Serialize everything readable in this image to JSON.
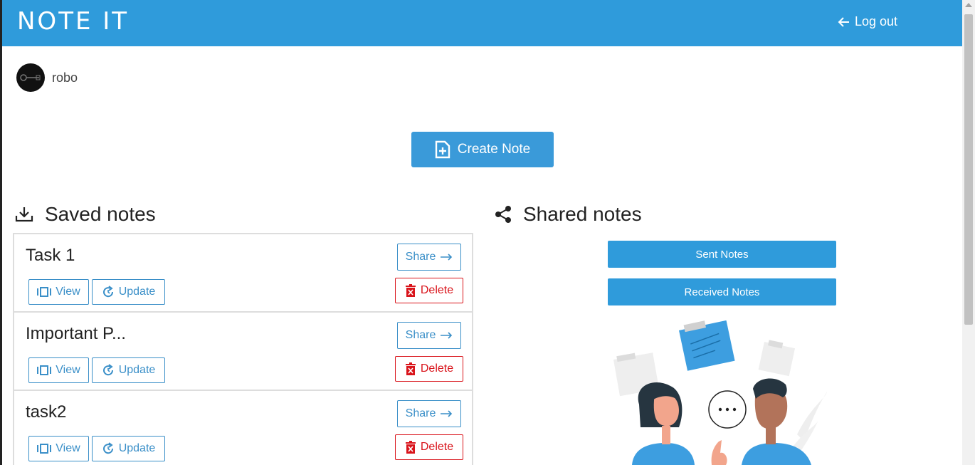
{
  "navbar": {
    "brand": "NOTE IT",
    "logout_label": "Log out"
  },
  "user": {
    "name": "robo"
  },
  "actions": {
    "create_note_label": "Create Note"
  },
  "saved": {
    "title": "Saved notes",
    "notes": [
      {
        "title": "Task 1",
        "share": "Share",
        "view": "View",
        "update": "Update",
        "delete": "Delete"
      },
      {
        "title": "Important P...",
        "share": "Share",
        "view": "View",
        "update": "Update",
        "delete": "Delete"
      },
      {
        "title": "task2",
        "share": "Share",
        "view": "View",
        "update": "Update",
        "delete": "Delete"
      }
    ]
  },
  "shared": {
    "title": "Shared notes",
    "sent_label": "Sent Notes",
    "received_label": "Received Notes"
  },
  "colors": {
    "primary": "#2f9bdb",
    "danger": "#d9141b",
    "outline": "#3a8fc8"
  },
  "icons": [
    "arrow-left-icon",
    "download-icon",
    "share-icon",
    "file-plus-icon",
    "arrow-right-icon",
    "view-icon",
    "refresh-icon",
    "trash-icon"
  ]
}
